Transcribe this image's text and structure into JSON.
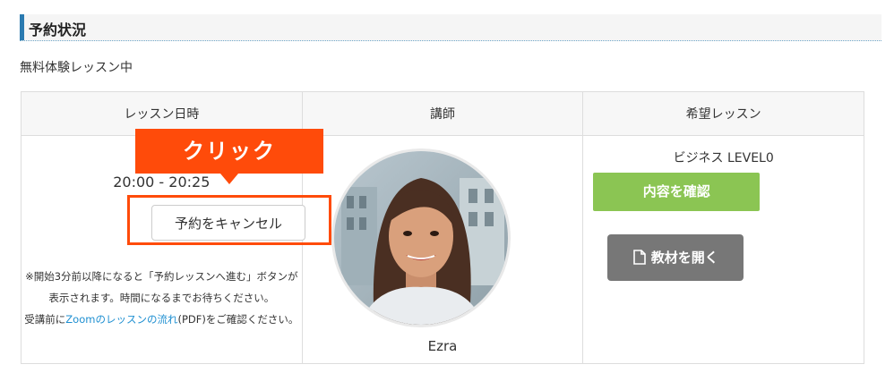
{
  "section": {
    "title": "予約状況"
  },
  "status_text": "無料体験レッスン中",
  "table": {
    "headers": [
      "レッスン日時",
      "講師",
      "希望レッスン"
    ],
    "lesson_time": "20:00 - 20:25",
    "cancel_button": "予約をキャンセル",
    "callout": "クリック",
    "note": {
      "line1": "※開始3分前以降になると「予約レッスンへ進む」ボタンが",
      "line2": "表示されます。時間になるまでお待ちください。",
      "line3_prefix": "受講前に",
      "line3_link": "Zoomのレッスンの流れ",
      "line3_suffix": "(PDF)をご確認ください。"
    },
    "tutor": {
      "name": "Ezra"
    },
    "course": {
      "name": "ビジネス LEVEL0",
      "confirm_button": "内容を確認",
      "material_button": "教材を開く",
      "material_icon": "file-icon"
    }
  },
  "colors": {
    "accent_bar": "#2a7ab0",
    "callout": "#ff4b0a",
    "confirm": "#8bc553",
    "material": "#777777",
    "link": "#1e8fd1"
  }
}
